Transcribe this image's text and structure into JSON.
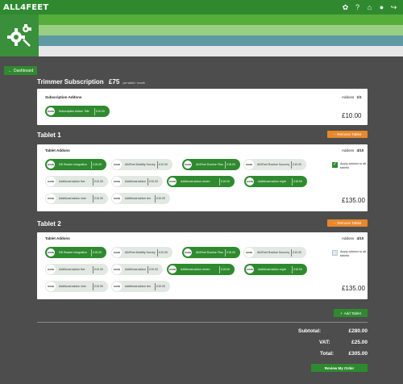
{
  "header": {
    "logo": "ALL4FEET",
    "icons": [
      "settings-icon",
      "help-icon",
      "home-icon",
      "user-icon",
      "logout-icon"
    ]
  },
  "nav": {
    "dashboard_label": "Dashboard"
  },
  "subscription": {
    "title": "Trimmer Subscription",
    "price": "£75",
    "period": "per tablet / month",
    "addons_label": "Subscription Addons",
    "addons_count_label": "Addons",
    "addons_count": "1/1",
    "addon": {
      "icon": "ICON",
      "name": "Subscription Addon Title",
      "price": "£10.00"
    },
    "total": "£10.00"
  },
  "tablets": [
    {
      "title": "Tablet 1",
      "remove_label": "Remove Tablet",
      "addons_label": "Tablet Addons",
      "addons_count_label": "Addons",
      "addons_count": "4/10",
      "apply_label": "Apply addons to all tablets",
      "apply_checked": true,
      "total": "£135.00",
      "addons": [
        {
          "icon": "ICON",
          "name": "DB Reader Integration",
          "price": "£15.00",
          "selected": true
        },
        {
          "icon": "ICON",
          "name": "All4Feet Mobility Survey",
          "price": "£10.00",
          "selected": false
        },
        {
          "icon": "ICON",
          "name": "All4Feet Routine Planner",
          "price": "£15.00",
          "selected": true
        },
        {
          "icon": "ICON",
          "name": "All4Feet Routine Sourcing",
          "price": "£10.00",
          "selected": false
        },
        {
          "icon": "ICON",
          "name": "Additional addon five",
          "price": "£10.00",
          "selected": false
        },
        {
          "icon": "ICON",
          "name": "Additional addon six",
          "price": "£10.00",
          "selected": false
        },
        {
          "icon": "ICON",
          "name": "Additional addon seven",
          "price": "£15.00",
          "selected": true
        },
        {
          "icon": "ICON",
          "name": "Additional addon eight",
          "price": "£15.00",
          "selected": true
        },
        {
          "icon": "ICON",
          "name": "Additional addon nine",
          "price": "£10.00",
          "selected": false
        },
        {
          "icon": "ICON",
          "name": "Additional addon ten",
          "price": "£10.00",
          "selected": false
        }
      ]
    },
    {
      "title": "Tablet 2",
      "remove_label": "Remove Tablet",
      "addons_label": "Tablet Addons",
      "addons_count_label": "Addons",
      "addons_count": "4/10",
      "apply_label": "Apply addons to all tablets",
      "apply_checked": false,
      "total": "£135.00",
      "addons": [
        {
          "icon": "ICON",
          "name": "DB Reader Integration",
          "price": "£15.00",
          "selected": true
        },
        {
          "icon": "ICON",
          "name": "All4Feet Mobility Survey",
          "price": "£10.00",
          "selected": false
        },
        {
          "icon": "ICON",
          "name": "All4Feet Routine Planner",
          "price": "£15.00",
          "selected": true
        },
        {
          "icon": "ICON",
          "name": "All4Feet Routine Sourcing",
          "price": "£10.00",
          "selected": false
        },
        {
          "icon": "ICON",
          "name": "Additional addon five",
          "price": "£10.00",
          "selected": false
        },
        {
          "icon": "ICON",
          "name": "Additional addon six",
          "price": "£10.00",
          "selected": false
        },
        {
          "icon": "ICON",
          "name": "Additional addon seven",
          "price": "£15.00",
          "selected": true
        },
        {
          "icon": "ICON",
          "name": "Additional addon eight",
          "price": "£15.00",
          "selected": true
        },
        {
          "icon": "ICON",
          "name": "Additional addon nine",
          "price": "£10.00",
          "selected": false
        },
        {
          "icon": "ICON",
          "name": "Additional addon ten",
          "price": "£10.00",
          "selected": false
        }
      ]
    }
  ],
  "actions": {
    "add_tablet_label": "Add Tablet",
    "review_label": "Review My Order"
  },
  "summary": {
    "subtotal_label": "Subtotal:",
    "subtotal": "£280.00",
    "vat_label": "VAT:",
    "vat": "£25.00",
    "total_label": "Total:",
    "total": "£305.00"
  },
  "colors": {
    "brand_green": "#2f8a2f",
    "orange": "#e8882c",
    "background": "#4d4d4d"
  }
}
